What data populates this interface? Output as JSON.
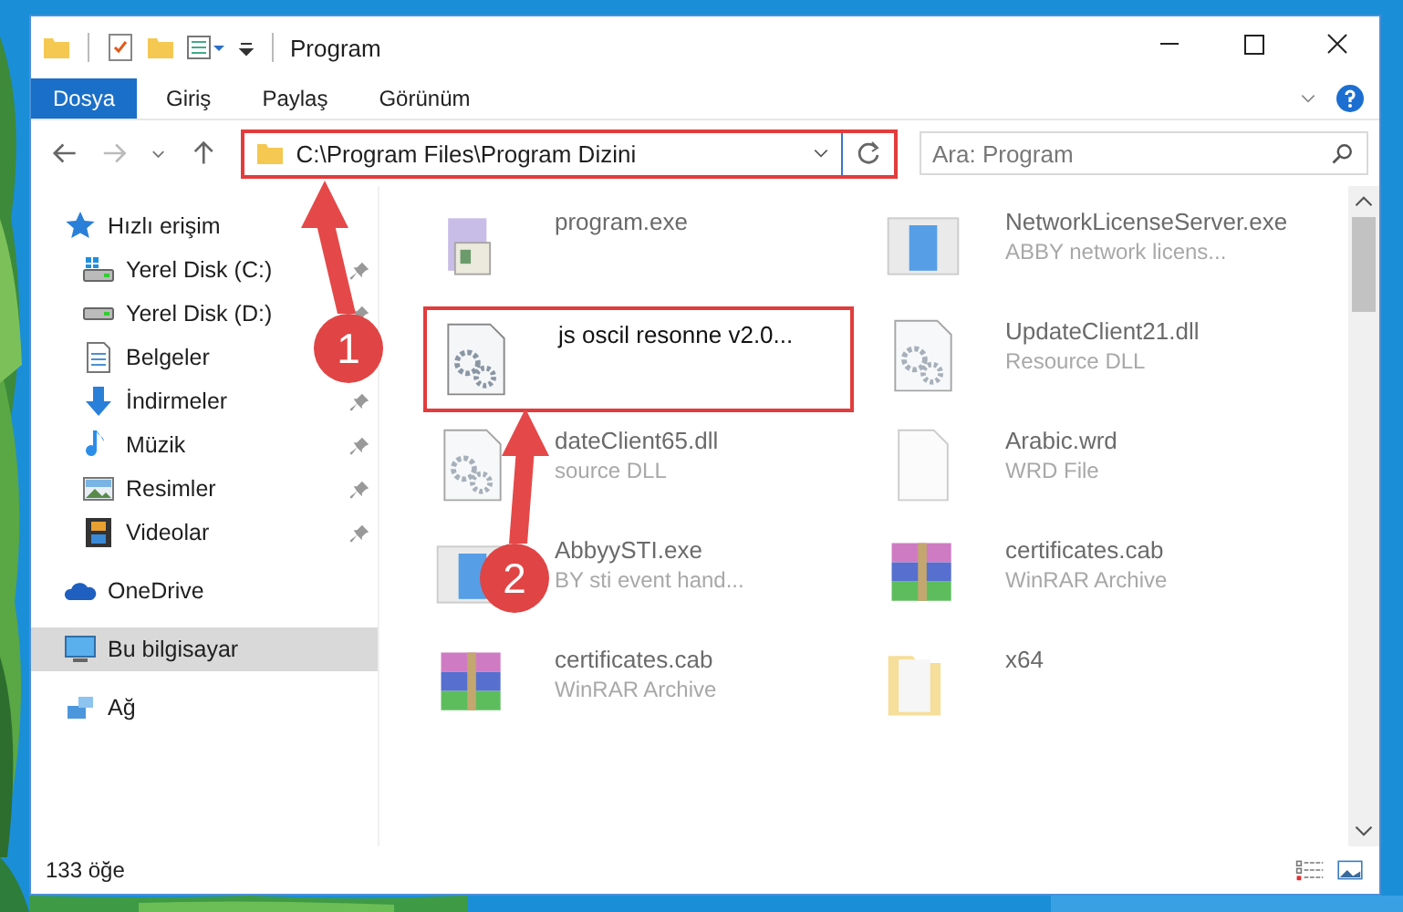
{
  "window": {
    "title": "Program"
  },
  "ribbon": {
    "tabs": [
      {
        "label": "Dosya",
        "kind": "file"
      },
      {
        "label": "Giriş",
        "kind": "tab"
      },
      {
        "label": "Paylaş",
        "kind": "tab"
      },
      {
        "label": "Görünüm",
        "kind": "tab"
      }
    ]
  },
  "address_bar": {
    "path": "C:\\Program Files\\Program Dizini",
    "highlighted": true
  },
  "search": {
    "placeholder": "Ara: Program"
  },
  "sidebar": {
    "items": [
      {
        "label": "Hızlı erişim",
        "kind": "star",
        "selected": false,
        "children": [
          {
            "label": "Yerel Disk (C:)",
            "kind": "drive-win",
            "pinned": true,
            "selected": false
          },
          {
            "label": "Yerel Disk (D:)",
            "kind": "drive",
            "pinned": true,
            "selected": false
          },
          {
            "label": "Belgeler",
            "kind": "docs",
            "selected": false
          },
          {
            "label": "İndirmeler",
            "kind": "download",
            "pinned": true,
            "selected": false
          },
          {
            "label": "Müzik",
            "kind": "music",
            "pinned": true,
            "selected": false
          },
          {
            "label": "Resimler",
            "kind": "pictures",
            "pinned": true,
            "selected": false
          },
          {
            "label": "Videolar",
            "kind": "video",
            "pinned": true,
            "selected": false
          }
        ]
      },
      {
        "label": "OneDrive",
        "kind": "cloud",
        "selected": false
      },
      {
        "label": "Bu bilgisayar",
        "kind": "pc",
        "selected": true
      },
      {
        "label": "Ağ",
        "kind": "network",
        "selected": false
      }
    ]
  },
  "content": {
    "files": [
      {
        "name": "program.exe",
        "kind": "installer",
        "blurred": true,
        "highlighted": false
      },
      {
        "name": "NetworkLicenseServer.exe",
        "description": "ABBY network licens...",
        "kind": "app",
        "blurred": true,
        "highlighted": false
      },
      {
        "name": "js oscil resonne v2.0...",
        "kind": "gear",
        "blurred": false,
        "highlighted": true
      },
      {
        "name": "UpdateClient21.dll",
        "description": "Resource DLL",
        "kind": "gear",
        "blurred": true,
        "highlighted": false
      },
      {
        "name": "dateClient65.dll",
        "description": "source DLL",
        "kind": "gear",
        "blurred": true,
        "highlighted": false
      },
      {
        "name": "Arabic.wrd",
        "description": "WRD File",
        "kind": "blank",
        "blurred": true,
        "highlighted": false
      },
      {
        "name": "AbbyySTI.exe",
        "description": "BY sti event hand...",
        "kind": "app",
        "blurred": true,
        "highlighted": false
      },
      {
        "name": "certificates.cab",
        "description": "WinRAR Archive",
        "kind": "rar",
        "blurred": true,
        "highlighted": false
      },
      {
        "name": "certificates.cab",
        "description": "WinRAR Archive",
        "kind": "rar",
        "blurred": true,
        "highlighted": false
      },
      {
        "name": "x64",
        "kind": "folder",
        "blurred": true,
        "highlighted": false
      }
    ]
  },
  "status_bar": {
    "count": "133 öğe"
  },
  "callouts": [
    {
      "number": "1"
    },
    {
      "number": "2"
    }
  ]
}
